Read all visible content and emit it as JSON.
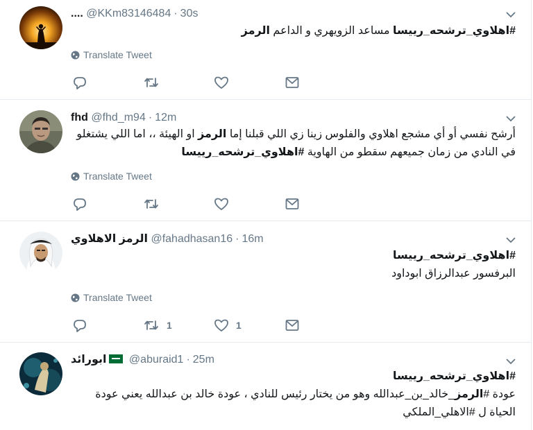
{
  "translate_label": "Translate Tweet",
  "colors": {
    "icon_gray": "#657786",
    "divider": "#e6ecf0",
    "flag_green": "#006c35"
  },
  "tweets": [
    {
      "name": "....",
      "handle": "@KKm83146484",
      "time": "30s",
      "body_parts": [
        {
          "text": "#اهلاوي_ترشحه_رييسا",
          "bold": true
        },
        {
          "text": " مساعد الزويهري و الداعم ",
          "bold": false
        },
        {
          "text": "الرمز",
          "bold": true
        }
      ],
      "replies": "",
      "retweets": "",
      "likes": ""
    },
    {
      "name": "fhd",
      "handle": "@fhd_m94",
      "time": "12m",
      "body_parts": [
        {
          "text": "أرشح نفسي أو أي مشجع اهلاوي والفلوس زينا زي اللي قبلنا إما ",
          "bold": false
        },
        {
          "text": "الرمز",
          "bold": true
        },
        {
          "text": " او الهيئة ،، اما اللي يشتغلو في النادي من زمان جميعهم سقطو من الهاوية ",
          "bold": false
        },
        {
          "text": "#اهلاوي_ترشحه_رييسا",
          "bold": true
        }
      ],
      "replies": "",
      "retweets": "",
      "likes": ""
    },
    {
      "name": "الرمز الاهلاوي",
      "handle": "@fahadhasan16",
      "time": "16m",
      "body_line1": "#اهلاوي_ترشحه_رييسا",
      "body_line2": "البرفسور عبدالرزاق ابوداود",
      "replies": "",
      "retweets": "1",
      "likes": "1"
    },
    {
      "name": "ابورائد",
      "handle": "@aburaid1",
      "time": "25m",
      "body_line1": "#اهلاوي_ترشحه_رييسا",
      "body_parts": [
        {
          "text": "عودة #",
          "bold": false
        },
        {
          "text": "الرمز",
          "bold": true
        },
        {
          "text": "_خالد_بن_عبدالله وهو من يختار رئيس للنادي ، عودة  خالد بن عبدالله يعني عودة الحياة ل #الاهلي_الملكي",
          "bold": false
        }
      ]
    }
  ]
}
